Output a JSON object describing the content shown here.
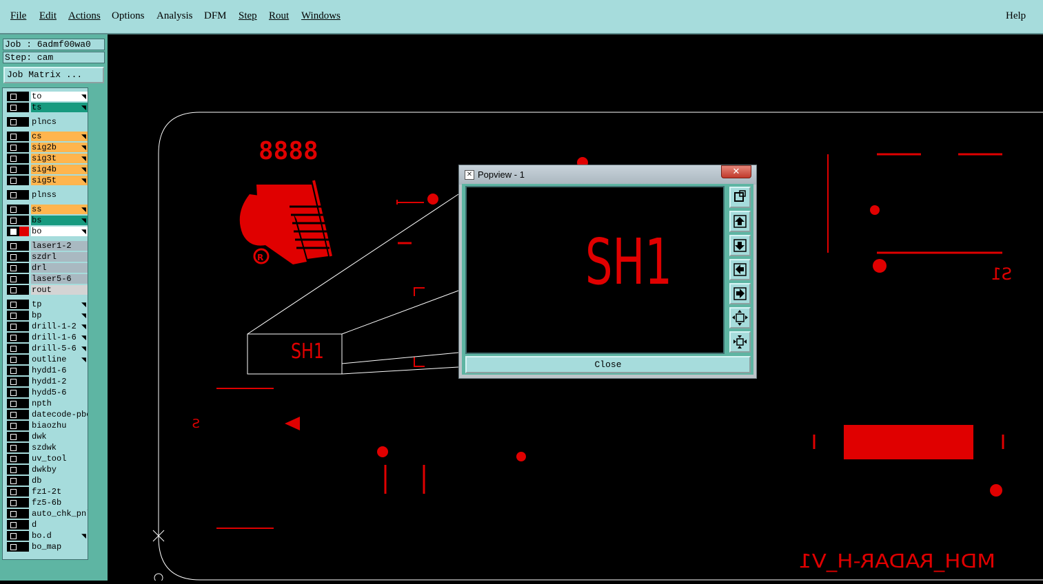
{
  "menu": {
    "file": "File",
    "edit": "Edit",
    "actions": "Actions",
    "options": "Options",
    "analysis": "Analysis",
    "dfm": "DFM",
    "step": "Step",
    "rout": "Rout",
    "windows": "Windows",
    "help": "Help"
  },
  "info": {
    "job": "Job : 6admf00wa0",
    "step": "Step: cam"
  },
  "job_matrix_label": "Job Matrix ...",
  "layers": [
    {
      "name": "to",
      "color": "#ffffff",
      "arrow": true
    },
    {
      "name": "ts",
      "color": "#179a7f",
      "arrow": true
    },
    {
      "name": "plncs",
      "color": "#a6dcdc",
      "arrow": false
    },
    {
      "name": "cs",
      "color": "#ffb54e",
      "arrow": true
    },
    {
      "name": "sig2b",
      "color": "#ffb54e",
      "arrow": true
    },
    {
      "name": "sig3t",
      "color": "#ffb54e",
      "arrow": true
    },
    {
      "name": "sig4b",
      "color": "#ffb54e",
      "arrow": true
    },
    {
      "name": "sig5t",
      "color": "#ffb54e",
      "arrow": true
    },
    {
      "name": "plnss",
      "color": "#a6dcdc",
      "arrow": false
    },
    {
      "name": "ss",
      "color": "#ffb54e",
      "arrow": true
    },
    {
      "name": "bs",
      "color": "#179a7f",
      "arrow": true
    },
    {
      "name": "bo",
      "color": "#ffffff",
      "arrow": true,
      "active": true
    },
    {
      "name": "laser1-2",
      "color": "#a9b9c1",
      "arrow": false
    },
    {
      "name": "szdrl",
      "color": "#a9b9c1",
      "arrow": false
    },
    {
      "name": "drl",
      "color": "#a9b9c1",
      "arrow": false
    },
    {
      "name": "laser5-6",
      "color": "#a9b9c1",
      "arrow": false
    },
    {
      "name": "rout",
      "color": "#d4d4d4",
      "arrow": false
    },
    {
      "name": "tp",
      "color": "#a6dcdc",
      "arrow": true
    },
    {
      "name": "bp",
      "color": "#a6dcdc",
      "arrow": true
    },
    {
      "name": "drill-1-2",
      "color": "#a6dcdc",
      "arrow": true
    },
    {
      "name": "drill-1-6",
      "color": "#a6dcdc",
      "arrow": true
    },
    {
      "name": "drill-5-6",
      "color": "#a6dcdc",
      "arrow": true
    },
    {
      "name": "outline",
      "color": "#a6dcdc",
      "arrow": true
    },
    {
      "name": "hydd1-6",
      "color": "#a6dcdc",
      "arrow": false
    },
    {
      "name": "hydd1-2",
      "color": "#a6dcdc",
      "arrow": false
    },
    {
      "name": "hydd5-6",
      "color": "#a6dcdc",
      "arrow": false
    },
    {
      "name": "npth",
      "color": "#a6dcdc",
      "arrow": false
    },
    {
      "name": "datecode-pbc",
      "color": "#a6dcdc",
      "arrow": false
    },
    {
      "name": "biaozhu",
      "color": "#a6dcdc",
      "arrow": false
    },
    {
      "name": "dwk",
      "color": "#a6dcdc",
      "arrow": false
    },
    {
      "name": "szdwk",
      "color": "#a6dcdc",
      "arrow": false
    },
    {
      "name": "uv_tool",
      "color": "#a6dcdc",
      "arrow": false
    },
    {
      "name": "dwkby",
      "color": "#a6dcdc",
      "arrow": false
    },
    {
      "name": "db",
      "color": "#a6dcdc",
      "arrow": false
    },
    {
      "name": "fz1-2t",
      "color": "#a6dcdc",
      "arrow": false
    },
    {
      "name": "fz5-6b",
      "color": "#a6dcdc",
      "arrow": false
    },
    {
      "name": "auto_chk_pnl",
      "color": "#a6dcdc",
      "arrow": false
    },
    {
      "name": "d",
      "color": "#a6dcdc",
      "arrow": false
    },
    {
      "name": "bo.d",
      "color": "#a6dcdc",
      "arrow": true
    },
    {
      "name": "bo_map",
      "color": "#a6dcdc",
      "arrow": false
    }
  ],
  "canvas": {
    "digits": "8888",
    "zoom_label": "SH1",
    "mirrored_text": "MDH_RADAR-H_V1",
    "mirrored_s1": "S1",
    "mirrored_s": "S",
    "logo_mark": "R",
    "copper_color": "#e00000"
  },
  "popview": {
    "title": "Popview - 1",
    "close_x": "✕",
    "window_icon": "✕",
    "view_text": "SH1",
    "close_label": "Close",
    "tools": [
      "zoom-fit-icon",
      "pan-up-icon",
      "pan-down-icon",
      "pan-left-icon",
      "pan-right-icon",
      "zoom-in-icon",
      "zoom-out-icon"
    ]
  }
}
